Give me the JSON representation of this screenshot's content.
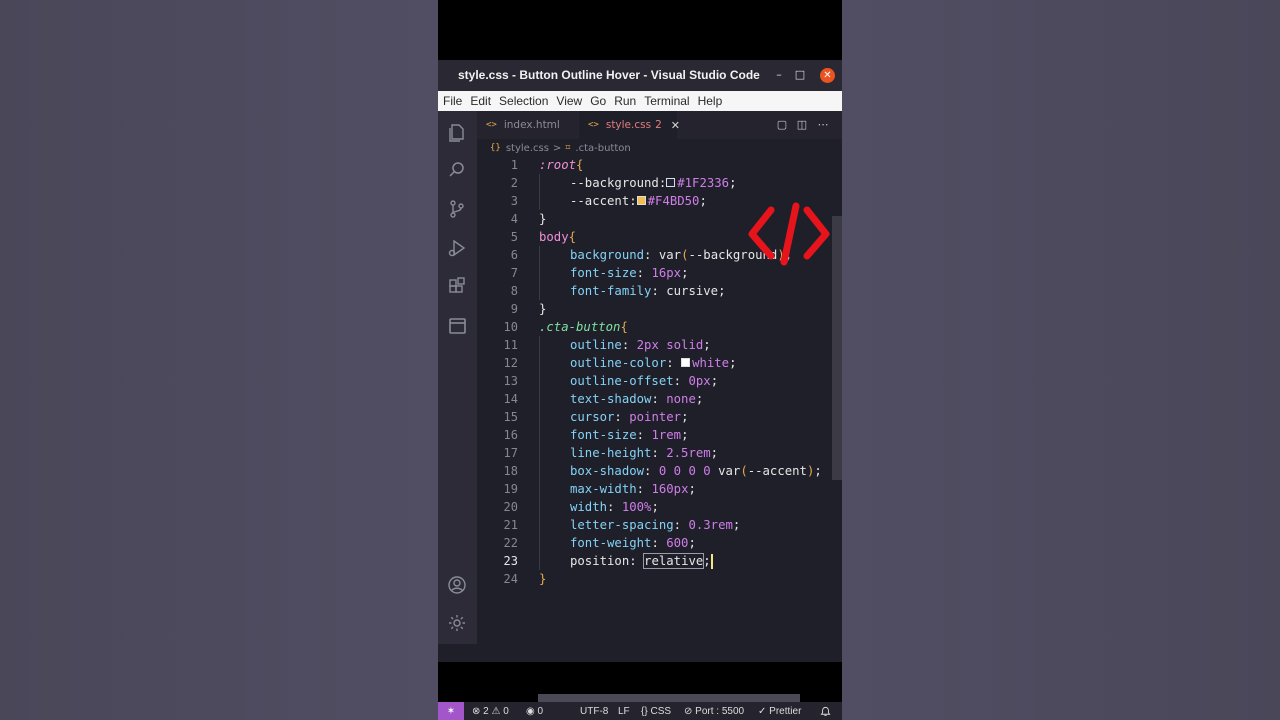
{
  "window": {
    "title": "style.css - Button Outline Hover - Visual Studio Code",
    "minimize_glyph": "–",
    "maximize_glyph": "□",
    "close_glyph": "✕"
  },
  "menu": [
    "File",
    "Edit",
    "Selection",
    "View",
    "Go",
    "Run",
    "Terminal",
    "Help"
  ],
  "activity_icons": [
    "explorer-icon",
    "search-icon",
    "source-control-icon",
    "run-debug-icon",
    "extensions-icon",
    "remote-explorer-icon",
    "account-icon",
    "settings-gear-icon"
  ],
  "tabs": [
    {
      "glyph": "<>",
      "label": "index.html",
      "active": false
    },
    {
      "glyph": "<>",
      "label": "style.css",
      "problems": "2",
      "close_glyph": "✕",
      "active": true
    }
  ],
  "tab_actions": {
    "compare": "▢",
    "split": "◫",
    "more": "⋯"
  },
  "breadcrumb": {
    "file_glyph": "{}",
    "file": "style.css",
    "separator": ">",
    "symbol_glyph": "⌗",
    "symbol": ".cta-button"
  },
  "editor": {
    "active_line": 23,
    "lines": [
      {
        "n": "1",
        "parts": [
          {
            "t": ":",
            "c": "pseudo"
          },
          {
            "t": "root",
            "c": "pseudo"
          },
          {
            "t": "{",
            "c": "br"
          }
        ]
      },
      {
        "n": "2",
        "indent": true,
        "parts": [
          {
            "t": "--background",
            "c": ""
          },
          {
            "t": ":",
            "c": ""
          },
          {
            "t": "swatch",
            "sw": "#1F2336"
          },
          {
            "t": "#1F2336",
            "c": "val"
          },
          {
            "t": ";",
            "c": ""
          }
        ]
      },
      {
        "n": "3",
        "indent": true,
        "parts": [
          {
            "t": "--accent",
            "c": ""
          },
          {
            "t": ":",
            "c": ""
          },
          {
            "t": "swatch",
            "sw": "#F4BD50"
          },
          {
            "t": "#F4BD50",
            "c": "val"
          },
          {
            "t": ";",
            "c": ""
          }
        ]
      },
      {
        "n": "4",
        "parts": [
          {
            "t": "}",
            "c": ""
          }
        ]
      },
      {
        "n": "5",
        "parts": [
          {
            "t": "body",
            "c": "sel"
          },
          {
            "t": "{",
            "c": "br"
          }
        ]
      },
      {
        "n": "6",
        "indent": true,
        "parts": [
          {
            "t": "background",
            "c": "prop"
          },
          {
            "t": ": ",
            "c": ""
          },
          {
            "t": "var",
            "c": ""
          },
          {
            "t": "(",
            "c": "br"
          },
          {
            "t": "--background",
            "c": ""
          },
          {
            "t": ")",
            "c": "br"
          },
          {
            "t": ";",
            "c": ""
          }
        ]
      },
      {
        "n": "7",
        "indent": true,
        "parts": [
          {
            "t": "font-size",
            "c": "prop"
          },
          {
            "t": ": ",
            "c": ""
          },
          {
            "t": "16px",
            "c": "val"
          },
          {
            "t": ";",
            "c": ""
          }
        ]
      },
      {
        "n": "8",
        "indent": true,
        "parts": [
          {
            "t": "font-family",
            "c": "prop"
          },
          {
            "t": ": ",
            "c": ""
          },
          {
            "t": "cursive",
            "c": ""
          },
          {
            "t": ";",
            "c": ""
          }
        ]
      },
      {
        "n": "9",
        "parts": [
          {
            "t": "}",
            "c": ""
          }
        ]
      },
      {
        "n": "10",
        "parts": [
          {
            "t": ".cta-button",
            "c": "cls"
          },
          {
            "t": "{",
            "c": "br"
          }
        ]
      },
      {
        "n": "11",
        "indent": true,
        "parts": [
          {
            "t": "outline",
            "c": "prop"
          },
          {
            "t": ": ",
            "c": ""
          },
          {
            "t": "2px solid",
            "c": "val"
          },
          {
            "t": ";",
            "c": ""
          }
        ]
      },
      {
        "n": "12",
        "indent": true,
        "parts": [
          {
            "t": "outline-color",
            "c": "prop"
          },
          {
            "t": ": ",
            "c": ""
          },
          {
            "t": "swatch",
            "sw": "#FFFFFF"
          },
          {
            "t": "white",
            "c": "val"
          },
          {
            "t": ";",
            "c": ""
          }
        ]
      },
      {
        "n": "13",
        "indent": true,
        "parts": [
          {
            "t": "outline-offset",
            "c": "prop"
          },
          {
            "t": ": ",
            "c": ""
          },
          {
            "t": "0px",
            "c": "val"
          },
          {
            "t": ";",
            "c": ""
          }
        ]
      },
      {
        "n": "14",
        "indent": true,
        "parts": [
          {
            "t": "text-shadow",
            "c": "prop"
          },
          {
            "t": ": ",
            "c": ""
          },
          {
            "t": "none",
            "c": "val"
          },
          {
            "t": ";",
            "c": ""
          }
        ]
      },
      {
        "n": "15",
        "indent": true,
        "parts": [
          {
            "t": "cursor",
            "c": "prop"
          },
          {
            "t": ": ",
            "c": ""
          },
          {
            "t": "pointer",
            "c": "val"
          },
          {
            "t": ";",
            "c": ""
          }
        ]
      },
      {
        "n": "16",
        "indent": true,
        "parts": [
          {
            "t": "font-size",
            "c": "prop"
          },
          {
            "t": ": ",
            "c": ""
          },
          {
            "t": "1rem",
            "c": "val"
          },
          {
            "t": ";",
            "c": ""
          }
        ]
      },
      {
        "n": "17",
        "indent": true,
        "parts": [
          {
            "t": "line-height",
            "c": "prop"
          },
          {
            "t": ": ",
            "c": ""
          },
          {
            "t": "2.5rem",
            "c": "val"
          },
          {
            "t": ";",
            "c": ""
          }
        ]
      },
      {
        "n": "18",
        "indent": true,
        "parts": [
          {
            "t": "box-shadow",
            "c": "prop"
          },
          {
            "t": ": ",
            "c": ""
          },
          {
            "t": "0 0 0 0 ",
            "c": "val"
          },
          {
            "t": "var",
            "c": ""
          },
          {
            "t": "(",
            "c": "br"
          },
          {
            "t": "--accent",
            "c": ""
          },
          {
            "t": ")",
            "c": "br"
          },
          {
            "t": ";",
            "c": ""
          }
        ]
      },
      {
        "n": "19",
        "indent": true,
        "parts": [
          {
            "t": "max-width",
            "c": "prop"
          },
          {
            "t": ": ",
            "c": ""
          },
          {
            "t": "160px",
            "c": "val"
          },
          {
            "t": ";",
            "c": ""
          }
        ]
      },
      {
        "n": "20",
        "indent": true,
        "parts": [
          {
            "t": "width",
            "c": "prop"
          },
          {
            "t": ": ",
            "c": ""
          },
          {
            "t": "100%",
            "c": "val"
          },
          {
            "t": ";",
            "c": ""
          }
        ]
      },
      {
        "n": "21",
        "indent": true,
        "parts": [
          {
            "t": "letter-spacing",
            "c": "prop"
          },
          {
            "t": ": ",
            "c": ""
          },
          {
            "t": "0.3rem",
            "c": "val"
          },
          {
            "t": ";",
            "c": ""
          }
        ]
      },
      {
        "n": "22",
        "indent": true,
        "parts": [
          {
            "t": "font-weight",
            "c": "prop"
          },
          {
            "t": ": ",
            "c": ""
          },
          {
            "t": "600",
            "c": "val"
          },
          {
            "t": ";",
            "c": ""
          }
        ]
      },
      {
        "n": "23",
        "indent": true,
        "parts": [
          {
            "t": "position",
            "c": ""
          },
          {
            "t": ": ",
            "c": ""
          },
          {
            "t": "relative",
            "c": "",
            "box": true
          },
          {
            "t": ";",
            "c": ""
          },
          {
            "t": "caret",
            "caret": true
          }
        ]
      },
      {
        "n": "24",
        "parts": [
          {
            "t": "}",
            "c": "br"
          }
        ]
      }
    ]
  },
  "statusbar": {
    "remote_glyph": "✶",
    "errors": "2",
    "warnings": "0",
    "ports_forwarded": "0",
    "encoding": "UTF-8",
    "eol": "LF",
    "language": "CSS",
    "live_server": "Port : 5500",
    "formatter": "Prettier",
    "bell_glyph": "🔔"
  },
  "colors": {
    "accent_error": "#e37d7d",
    "remote": "#a356c9",
    "logo_red": "#e8141b"
  }
}
